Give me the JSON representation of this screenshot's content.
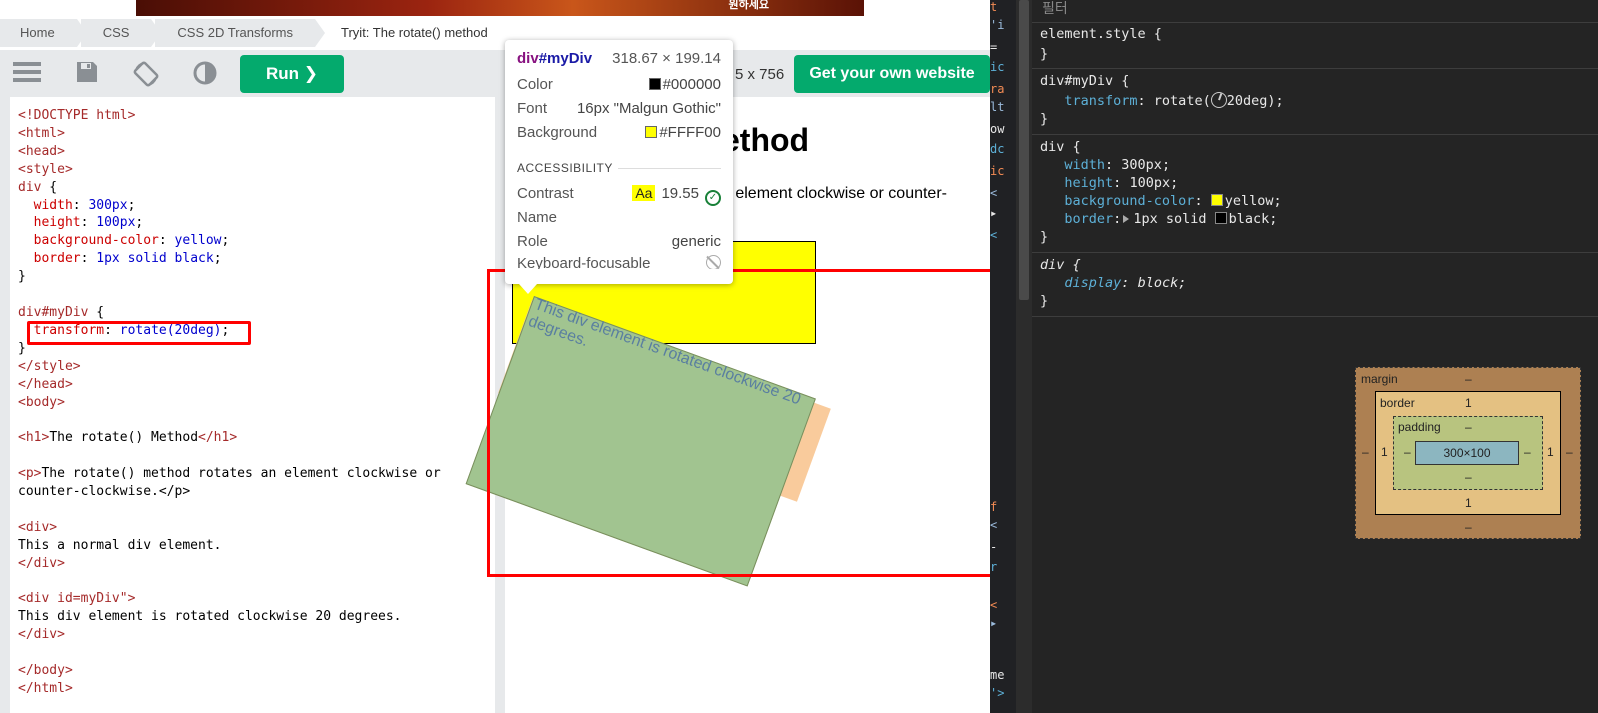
{
  "ad": {
    "text": "원하세요"
  },
  "breadcrumbs": [
    "Home",
    "CSS",
    "CSS 2D Transforms",
    "Tryit: The rotate() method"
  ],
  "toolbar": {
    "run_label": "Run ❯",
    "dimensions": "5 x 756",
    "get_website_label": "Get your own website"
  },
  "code_lines": [
    "<!DOCTYPE html>",
    "<html>",
    "<head>",
    "<style>",
    "div {",
    "  width: 300px;",
    "  height: 100px;",
    "  background-color: yellow;",
    "  border: 1px solid black;",
    "}",
    "",
    "div#myDiv {",
    "  transform: rotate(20deg);",
    "}",
    "</style>",
    "</head>",
    "<body>",
    "",
    "<h1>The rotate() Method</h1>",
    "",
    "<p>The rotate() method rotates an element clockwise or",
    "counter-clockwise.</p>",
    "",
    "<div>",
    "This a normal div element.",
    "</div>",
    "",
    "<div id=\"myDiv\">",
    "This div element is rotated clockwise 20 degrees.",
    "</div>",
    "",
    "</body>",
    "</html>"
  ],
  "result": {
    "h1_visible": "ethod",
    "p_visible": "n element clockwise or counter-",
    "rotated_text": "This div element is rotated clockwise 20 degrees."
  },
  "tooltip": {
    "selector_tag": "div",
    "selector_id": "#myDiv",
    "size": "318.67 × 199.14",
    "color_label": "Color",
    "color_value": "#000000",
    "color_hex": "#000000",
    "font_label": "Font",
    "font_value": "16px \"Malgun Gothic\"",
    "background_label": "Background",
    "background_value": "#FFFF00",
    "background_hex": "#FFFF00",
    "accessibility_title": "ACCESSIBILITY",
    "contrast_label": "Contrast",
    "contrast_aa": "Aa",
    "contrast_value": "19.55",
    "name_label": "Name",
    "role_label": "Role",
    "role_value": "generic",
    "keyboard_label": "Keyboard-focusable"
  },
  "devtools": {
    "filter_placeholder": "필터",
    "strip_chars": [
      "t",
      "'i",
      "=",
      "ic",
      "ra",
      "lt",
      "ow",
      "dc",
      "ic",
      "<",
      "▸",
      "<",
      "f",
      "<",
      "-",
      "r",
      "<",
      "▸",
      "me",
      "'>"
    ],
    "rules": [
      {
        "selector": "element.style",
        "props": []
      },
      {
        "selector": "div#myDiv",
        "props": [
          {
            "name": "transform",
            "value": "rotate(20deg)"
          }
        ]
      },
      {
        "selector": "div",
        "props": [
          {
            "name": "width",
            "value": "300px"
          },
          {
            "name": "height",
            "value": "100px"
          },
          {
            "name": "background-color",
            "value": "yellow"
          },
          {
            "name": "border",
            "value": "1px solid black"
          }
        ]
      },
      {
        "selector": "div",
        "props": [
          {
            "name": "display",
            "value": "block"
          }
        ]
      }
    ],
    "box_model": {
      "margin_label": "margin",
      "margin_value": "–",
      "border_label": "border",
      "border_value": "1",
      "padding_label": "padding",
      "padding_value": "–",
      "content": "300×100",
      "left_margin": "–",
      "right_margin": "–",
      "bottom_margin": "–",
      "left_border": "1",
      "right_border": "1",
      "bottom_border": "1",
      "left_padding": "–",
      "right_padding": "–",
      "bottom_padding": "–"
    }
  }
}
